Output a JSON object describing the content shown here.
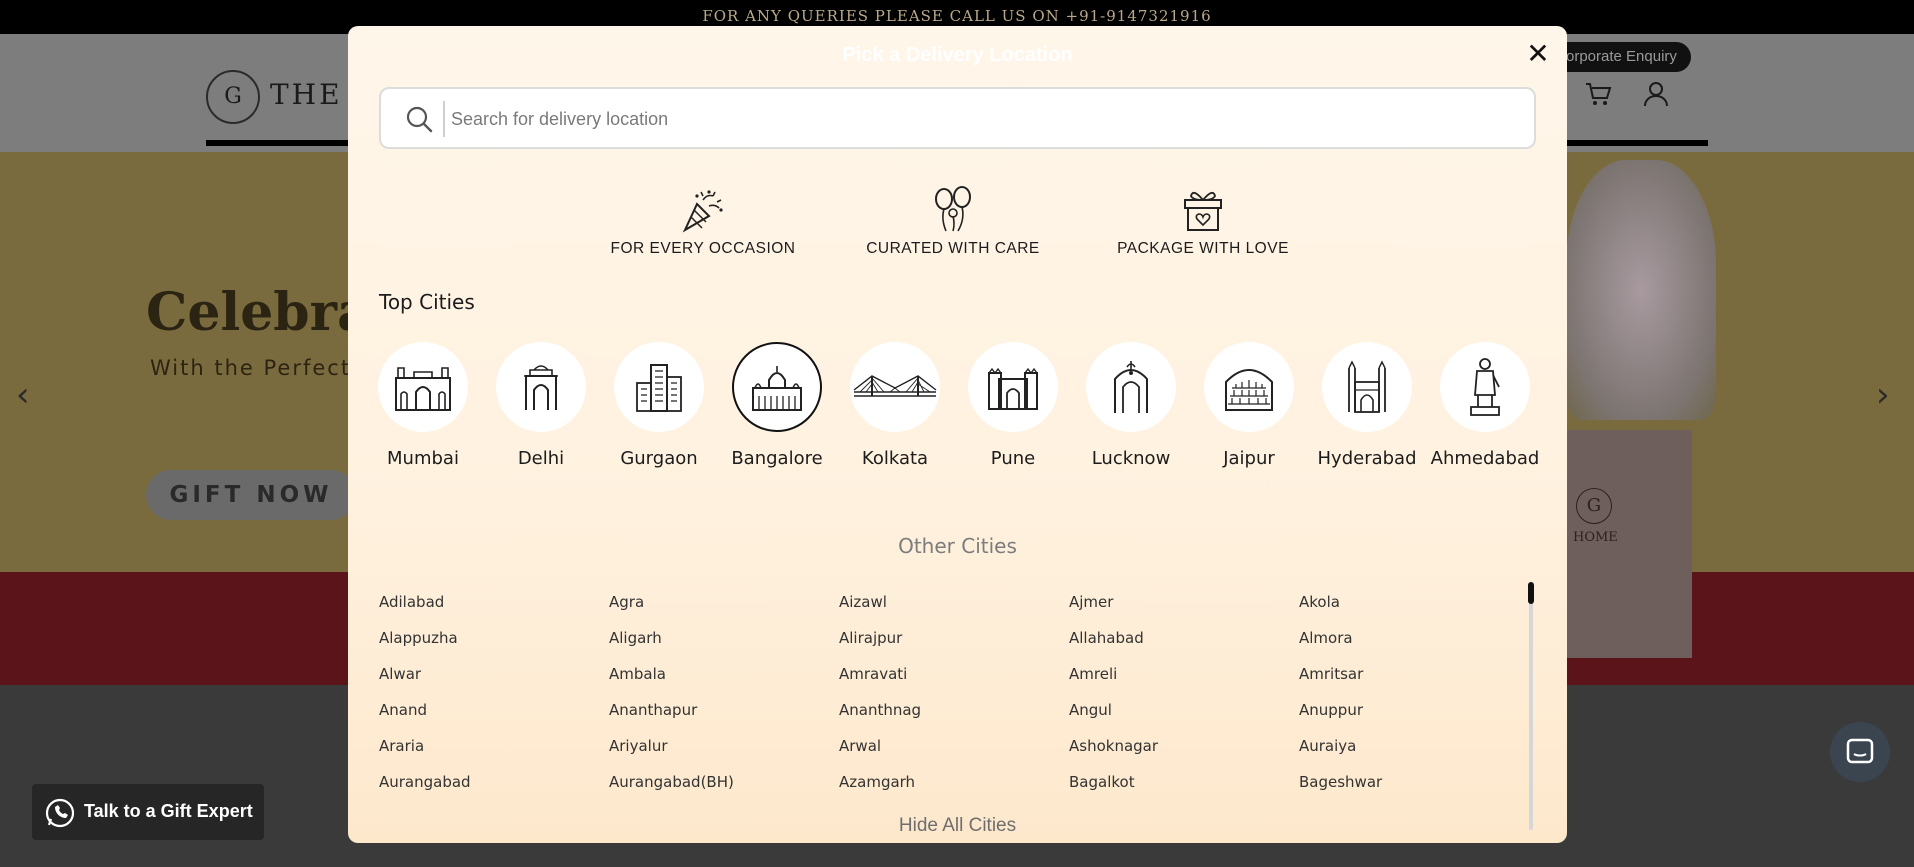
{
  "site": {
    "topbar_text": "FOR ANY QUERIES PLEASE CALL US ON +91-9147321916",
    "logo_letter": "G",
    "logo_text": "THE G",
    "corporate_button": "orporate Enquiry",
    "banner_title": "Celebrat",
    "banner_subtitle": "With the Perfect",
    "banner_cta": "GIFT NOW",
    "box_logo_letter": "G",
    "box_label": "HOME",
    "talk_button": "Talk to a Gift Expert"
  },
  "modal": {
    "title": "Pick a Delivery Location",
    "close_label": "✕",
    "search_placeholder": "Search for delivery location",
    "features": [
      {
        "label": "FOR EVERY OCCASION",
        "icon": "party-popper-icon"
      },
      {
        "label": "CURATED WITH CARE",
        "icon": "balloons-icon"
      },
      {
        "label": "PACKAGE WITH LOVE",
        "icon": "gift-box-icon"
      }
    ],
    "top_cities_title": "Top Cities",
    "top_cities": [
      {
        "name": "Mumbai",
        "icon": "gateway-of-india-icon"
      },
      {
        "name": "Delhi",
        "icon": "india-gate-icon"
      },
      {
        "name": "Gurgaon",
        "icon": "skyscraper-icon"
      },
      {
        "name": "Bangalore",
        "icon": "vidhana-soudha-icon",
        "selected": true
      },
      {
        "name": "Kolkata",
        "icon": "howrah-bridge-icon"
      },
      {
        "name": "Pune",
        "icon": "shaniwar-wada-icon"
      },
      {
        "name": "Lucknow",
        "icon": "rumi-darwaza-icon"
      },
      {
        "name": "Jaipur",
        "icon": "hawa-mahal-icon"
      },
      {
        "name": "Hyderabad",
        "icon": "charminar-icon"
      },
      {
        "name": "Ahmedabad",
        "icon": "statue-icon"
      }
    ],
    "other_cities_title": "Other Cities",
    "other_cities": [
      "Adilabad",
      "Agra",
      "Aizawl",
      "Ajmer",
      "Akola",
      "Alappuzha",
      "Aligarh",
      "Alirajpur",
      "Allahabad",
      "Almora",
      "Alwar",
      "Ambala",
      "Amravati",
      "Amreli",
      "Amritsar",
      "Anand",
      "Ananthapur",
      "Ananthnag",
      "Angul",
      "Anuppur",
      "Araria",
      "Ariyalur",
      "Arwal",
      "Ashoknagar",
      "Auraiya",
      "Aurangabad",
      "Aurangabad(BH)",
      "Azamgarh",
      "Bagalkot",
      "Bageshwar"
    ],
    "hide_all_label": "Hide All Cities"
  },
  "colors": {
    "modal_bg": "#fff3e3",
    "text_dark": "#1c1c1c",
    "muted": "#7c7c7c"
  }
}
